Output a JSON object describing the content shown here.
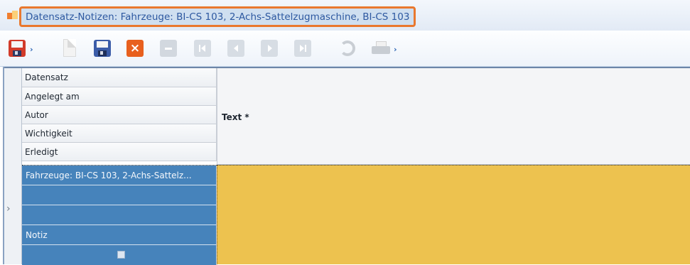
{
  "window": {
    "title": "Datensatz-Notizen: Fahrzeuge: BI-CS 103, 2-Achs-Sattelzugmaschine, BI-CS 103",
    "title_color": "#2d58a0",
    "highlight_color": "#e9782e"
  },
  "toolbar": {
    "buttons": [
      {
        "name": "save-dropdown",
        "icon": "floppy-disk-red-icon"
      },
      {
        "name": "new-document",
        "icon": "blank-document-icon"
      },
      {
        "name": "save",
        "icon": "floppy-disk-blue-icon"
      },
      {
        "name": "delete",
        "icon": "close-x-icon"
      },
      {
        "name": "remove",
        "icon": "minus-icon"
      },
      {
        "name": "first-record",
        "icon": "first-record-icon"
      },
      {
        "name": "previous-record",
        "icon": "previous-record-icon"
      },
      {
        "name": "next-record",
        "icon": "next-record-icon"
      },
      {
        "name": "last-record",
        "icon": "last-record-icon"
      },
      {
        "name": "refresh",
        "icon": "refresh-icon"
      },
      {
        "name": "print",
        "icon": "printer-icon"
      }
    ]
  },
  "grid": {
    "headers": [
      "Datensatz",
      "Angelegt am",
      "Autor",
      "Wichtigkeit",
      "Erledigt"
    ],
    "text_header": "Text *",
    "selected_row": {
      "datensatz": "Fahrzeuge: BI-CS 103, 2-Achs-Sattelz...",
      "angelegt_am": "",
      "autor": "",
      "wichtigkeit": "Notiz",
      "erledigt": false,
      "text": ""
    },
    "row_indicator": "›",
    "selected_row_color": "#4683bb",
    "editor_color": "#edc24f"
  }
}
